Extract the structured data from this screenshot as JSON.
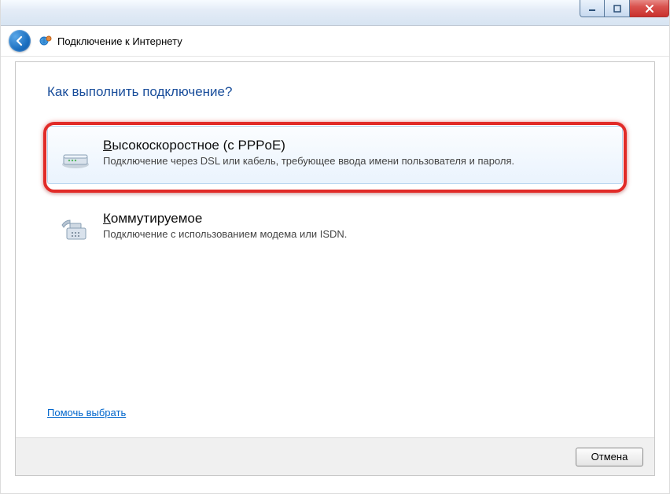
{
  "window": {
    "wizard_title": "Подключение к Интернету"
  },
  "heading": "Как выполнить подключение?",
  "options": [
    {
      "title_prefix": "В",
      "title_rest": "ысокоскоростное (с PPPoE)",
      "desc": "Подключение через DSL или кабель, требующее ввода имени пользователя и пароля."
    },
    {
      "title_prefix": "К",
      "title_rest": "оммутируемое",
      "desc": "Подключение с использованием модема или ISDN."
    }
  ],
  "help_link": "Помочь выбрать",
  "buttons": {
    "cancel": "Отмена"
  }
}
